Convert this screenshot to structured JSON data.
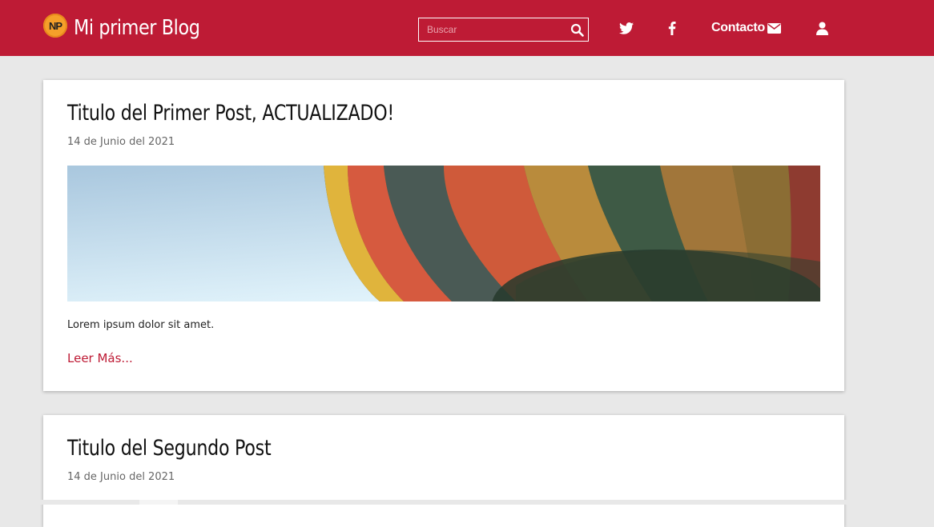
{
  "header": {
    "logo_text": "NP",
    "brand": "Mi primer Blog",
    "search": {
      "placeholder": "Buscar",
      "value": ""
    },
    "nav": {
      "twitter_icon": "twitter-icon",
      "facebook_icon": "facebook-icon",
      "contact_label": "Contacto",
      "contact_icon": "envelope-icon",
      "user_icon": "user-icon"
    }
  },
  "posts": [
    {
      "title": "Titulo del Primer Post, ACTUALIZADO!",
      "date": "14 de Junio del 2021",
      "excerpt": "Lorem ipsum dolor sit amet.",
      "read_more": "Leer Más..."
    },
    {
      "title": "Titulo del Segundo Post",
      "date": "14 de Junio del 2021"
    }
  ],
  "colors": {
    "primary": "#be1b35",
    "background": "#e8e8e8",
    "card": "#ffffff"
  }
}
